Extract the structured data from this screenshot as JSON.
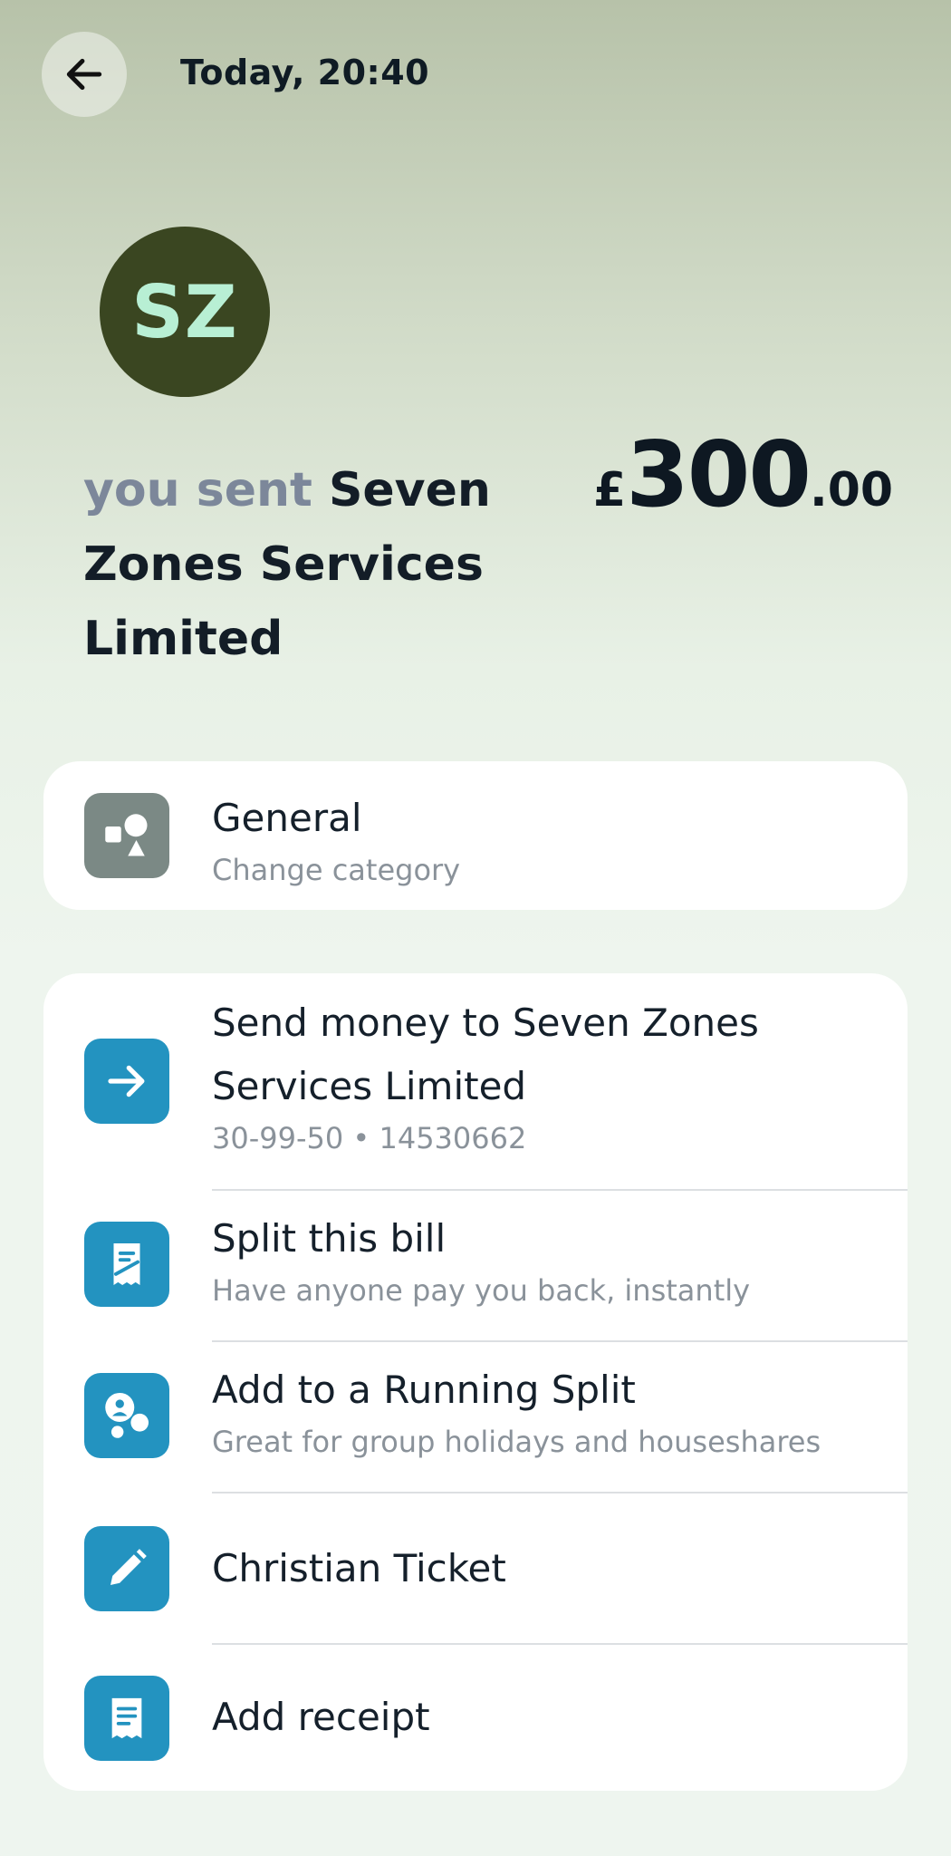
{
  "header": {
    "back_label": "Back",
    "timestamp": "Today, 20:40"
  },
  "merchant": {
    "initials": "SZ",
    "avatar_color": "#3a4621",
    "initials_color": "#b8efd4"
  },
  "transaction": {
    "prefix": "you sent",
    "recipient": "Seven Zones Services Limited",
    "currency_symbol": "£",
    "amount_whole": "300",
    "amount_pence": ".00"
  },
  "category": {
    "title": "General",
    "subtitle": "Change category",
    "icon": "shapes-icon"
  },
  "actions": [
    {
      "title": "Send money to Seven Zones Services Limited",
      "subtitle": "30-99-50 • 14530662",
      "icon": "arrow-right-icon"
    },
    {
      "title": "Split this bill",
      "subtitle": "Have anyone pay you back, instantly",
      "icon": "split-bill-icon"
    },
    {
      "title": "Add to a Running Split",
      "subtitle": "Great for group holidays and houseshares",
      "icon": "running-split-icon"
    },
    {
      "title": "Christian Ticket",
      "icon": "pencil-icon"
    },
    {
      "title": "Add receipt",
      "icon": "receipt-icon"
    }
  ],
  "colors": {
    "accent_blue": "#2393c0",
    "category_grey": "#7b8985"
  }
}
